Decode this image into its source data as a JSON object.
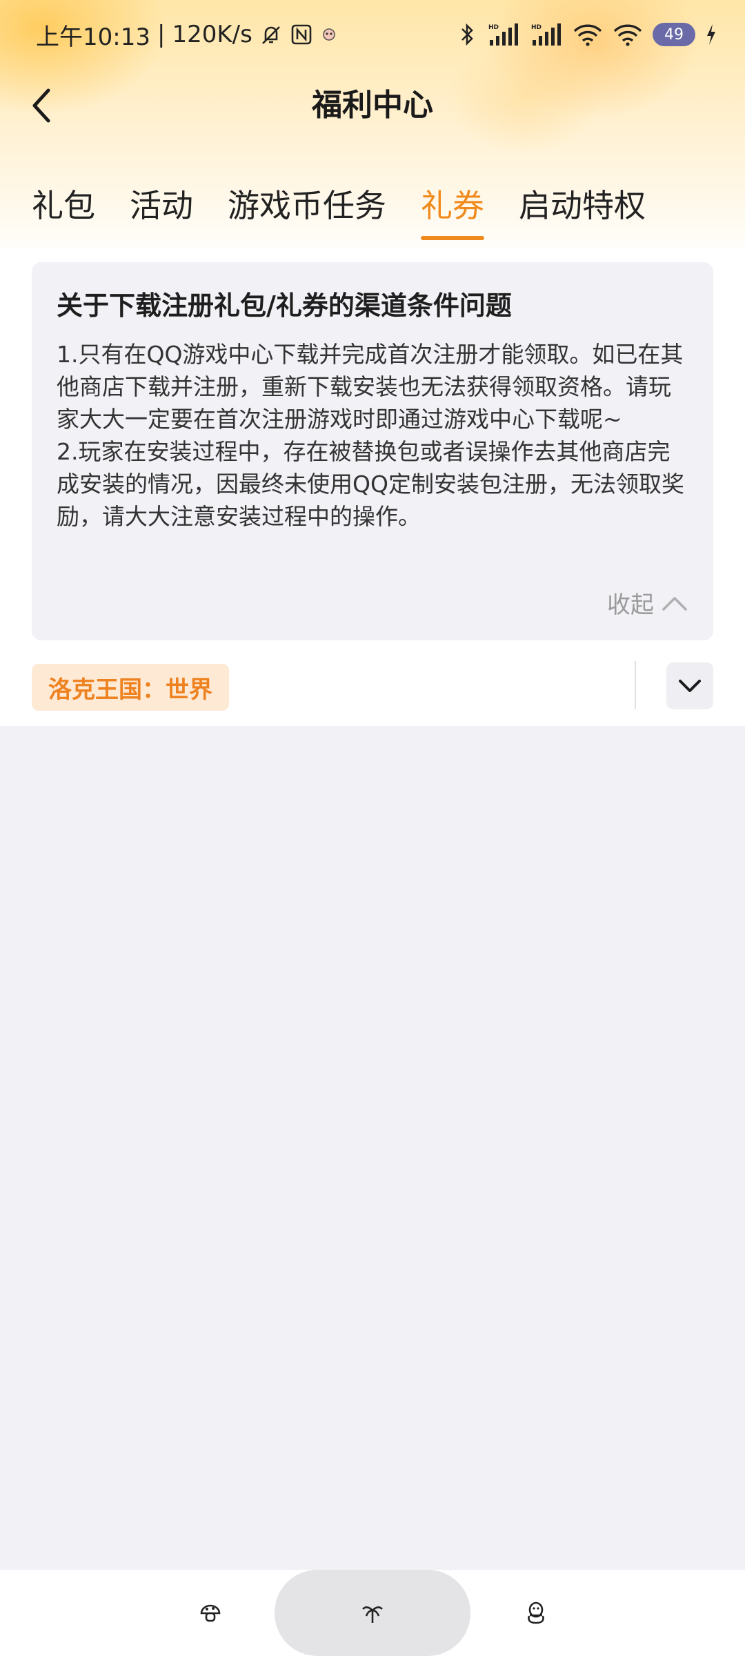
{
  "status_bar": {
    "time": "上午10:13",
    "separator": "|",
    "speed": "120K/s",
    "battery_level": "49"
  },
  "header": {
    "title": "福利中心"
  },
  "tabs": [
    {
      "label": "礼包",
      "active": false
    },
    {
      "label": "活动",
      "active": false
    },
    {
      "label": "游戏币任务",
      "active": false
    },
    {
      "label": "礼券",
      "active": true
    },
    {
      "label": "启动特权",
      "active": false
    }
  ],
  "notice": {
    "title": "关于下载注册礼包/礼券的渠道条件问题",
    "paragraphs": [
      "1.只有在QQ游戏中心下载并完成首次注册才能领取。如已在其他商店下载并注册，重新下载安装也无法获得领取资格。请玩家大大一定要在首次注册游戏时即通过游戏中心下载呢~",
      "2.玩家在安装过程中，存在被替换包或者误操作去其他商店完成安装的情况，因最终未使用QQ定制安装包注册，无法领取奖励，请大大注意安装过程中的操作。"
    ],
    "collapse_label": "收起"
  },
  "filter": {
    "selected_game": "洛克王国：世界"
  },
  "colors": {
    "accent": "#f08a1c",
    "chip_bg": "#fde9d4",
    "page_bg": "#f1f1f6"
  },
  "icons": {
    "back": "back-arrow-icon",
    "collapse": "chevron-up-icon",
    "dropdown": "chevron-down-icon",
    "nav_left": "mushroom-icon",
    "nav_center": "palm-tree-icon",
    "nav_right": "penguin-icon"
  }
}
